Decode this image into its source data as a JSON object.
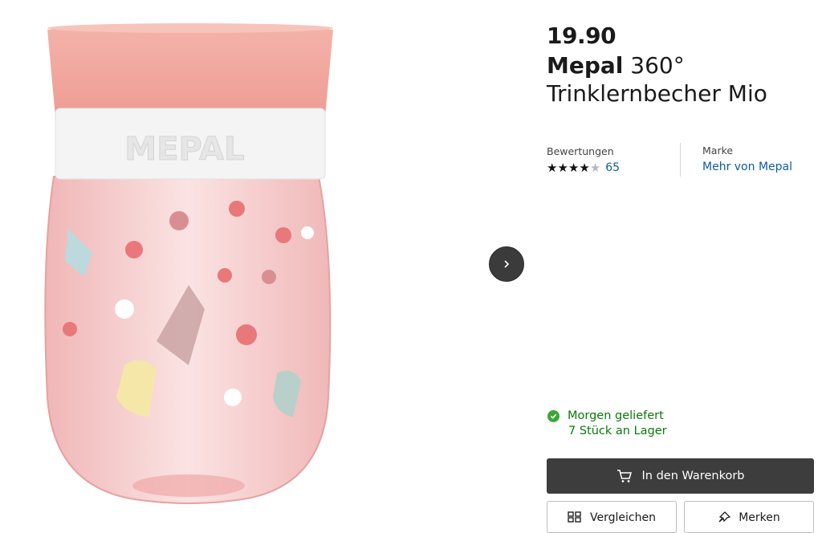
{
  "product": {
    "price": "19.90",
    "brand": "Mepal",
    "name_rest": " 360°",
    "name_line2": "Trinklernbecher Mio",
    "image_brand_text": "MEPAL"
  },
  "rating": {
    "label": "Bewertungen",
    "stars_filled": 4,
    "stars_total": 5,
    "count": "65"
  },
  "brand_section": {
    "label": "Marke",
    "link": "Mehr von Mepal"
  },
  "delivery": {
    "status": "Morgen geliefert",
    "stock": "7 Stück an Lager"
  },
  "buttons": {
    "cart": "In den Warenkorb",
    "compare": "Vergleichen",
    "note": "Merken"
  },
  "colors": {
    "accent_green": "#3aa637",
    "link_blue": "#0e5ca1",
    "button_dark": "#3d3d3d",
    "lid_pink": "#f2a79e"
  }
}
